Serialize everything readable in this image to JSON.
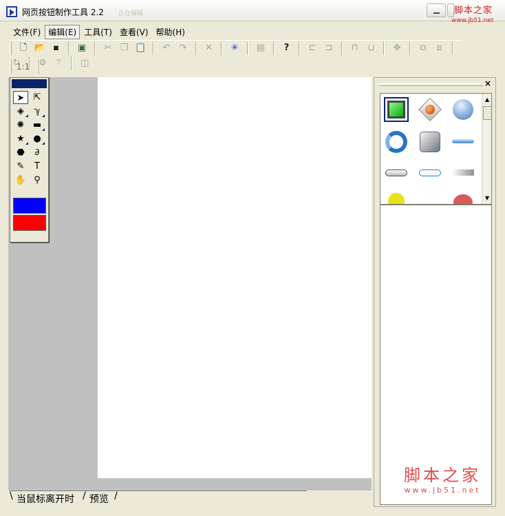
{
  "window": {
    "title": "网页按钮制作工具 2.2",
    "title_ghost": "正在编辑",
    "watermark_top": "脚本之家",
    "watermark_top_url": "www.jb51.net"
  },
  "menu": {
    "items": [
      "文件(F)",
      "编辑(E)",
      "工具(T)",
      "查看(V)",
      "帮助(H)"
    ],
    "active_index": 1
  },
  "toolbar": {
    "ratio_label": "1:1",
    "play_glyph": "▶"
  },
  "toolbox": {
    "fill_color": "#0000ff",
    "stroke_color": "#ff0000",
    "caption_color": "#0a246a"
  },
  "tabs": {
    "items": [
      "当鼠标离开时",
      "预览"
    ]
  },
  "right_panel": {
    "close_glyph": "×",
    "watermark_text": "脚本之家",
    "watermark_url": "www.jb51.net"
  },
  "colors": {
    "workspace": "#c0c0c0",
    "canvas": "#ffffff",
    "accent_red": "#e04e4e",
    "accent_blue": "#0a246a"
  }
}
